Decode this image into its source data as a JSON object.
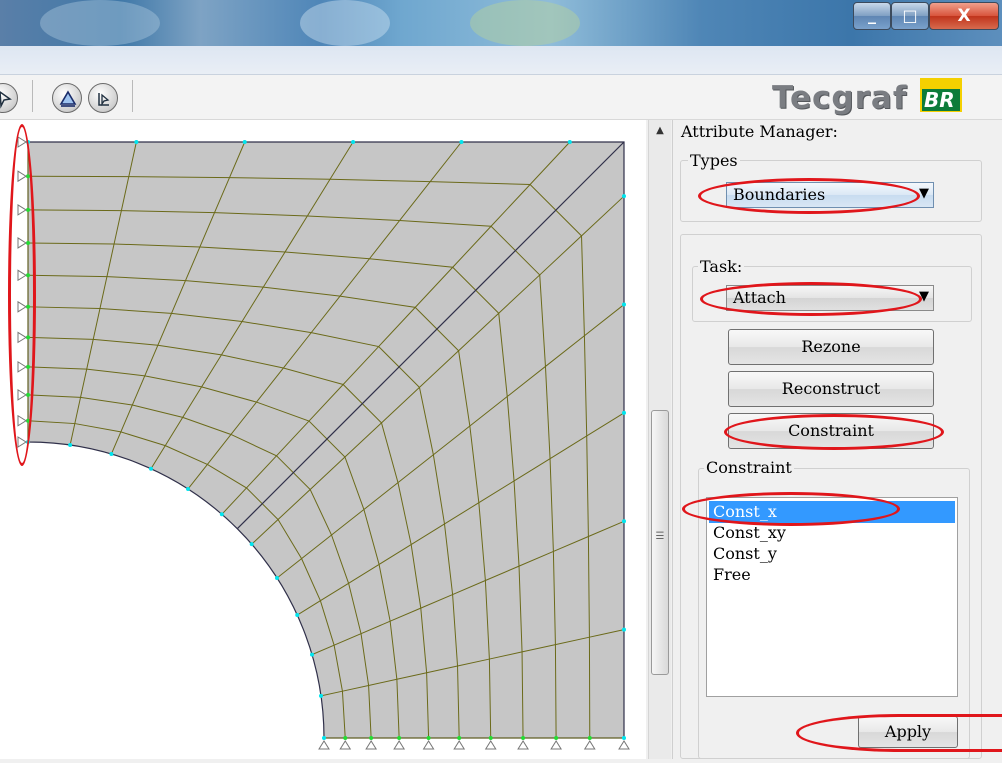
{
  "window": {
    "minimize_glyph": "_",
    "maximize_glyph": "□",
    "close_glyph": "X"
  },
  "logo": {
    "text": "Tecgraf",
    "badge": "BR"
  },
  "toolbar": {
    "icons": [
      "select-icon",
      "boundary-triangle-icon",
      "rotate-select-icon"
    ]
  },
  "panel": {
    "title": "Attribute Manager:",
    "types_label": "Types",
    "types_value": "Boundaries",
    "task_label": "Task:",
    "task_value": "Attach",
    "buttons": {
      "rezone": "Rezone",
      "reconstruct": "Reconstruct",
      "constraint": "Constraint"
    },
    "constraint_label": "Constraint",
    "constraint_items": [
      "Const_x",
      "Const_xy",
      "Const_y",
      "Free"
    ],
    "selected_item": "Const_x",
    "apply": "Apply"
  },
  "colors": {
    "mesh_fill": "#c6c6c6",
    "mesh_lines": "#6b6a1a",
    "node_cyan": "#00e5ee",
    "node_green": "#22dd33",
    "annotation": "#e0161b",
    "selection": "#3399ff"
  }
}
